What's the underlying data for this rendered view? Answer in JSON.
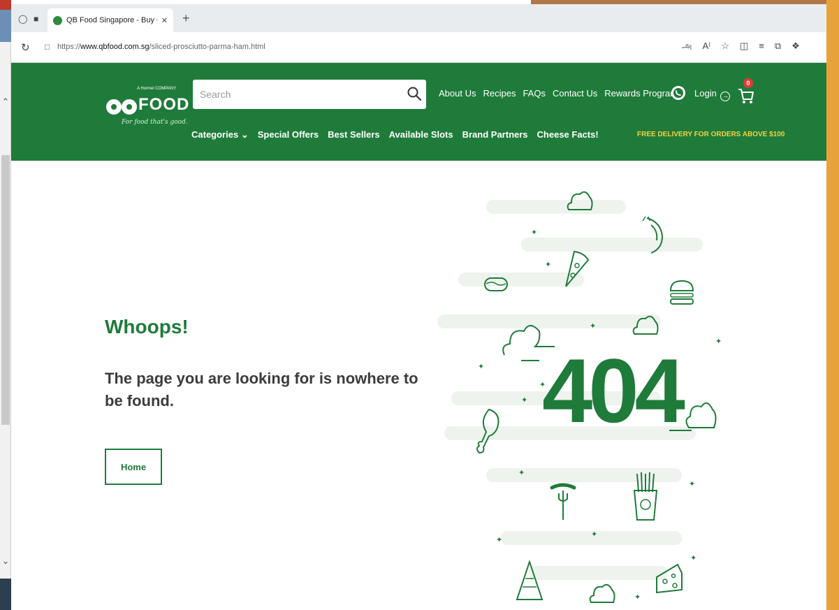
{
  "browser": {
    "tab_title": "QB Food Singapore - Buy Quality",
    "url_scheme": "https://",
    "url_host": "www.qbfood.com.sg",
    "url_path": "/sliced-prosciutto-parma-ham.html"
  },
  "header": {
    "logo": {
      "mark": "qb",
      "text": "FOOD",
      "company_line": "A Hormel COMPANY",
      "tagline": "For food that's good."
    },
    "search": {
      "placeholder": "Search"
    },
    "top_nav": [
      "About Us",
      "Recipes",
      "FAQs",
      "Contact Us",
      "Rewards Program"
    ],
    "login_label": "Login",
    "cart_count": "0",
    "sub_nav": {
      "categories_label": "Categories",
      "items": [
        "Special Offers",
        "Best Sellers",
        "Available Slots",
        "Brand Partners",
        "Cheese Facts!"
      ]
    },
    "free_delivery": "FREE DELIVERY FOR ORDERS ABOVE $100"
  },
  "main": {
    "heading": "Whoops!",
    "message": "The page you are looking for is nowhere to be found.",
    "home_button": "Home",
    "error_code": "404"
  },
  "colors": {
    "brand_green": "#1f7b3a",
    "delivery_yellow": "#f4d03f",
    "cart_badge": "#e53935"
  },
  "icons": [
    "reload-icon",
    "lock-icon",
    "search-icon",
    "whatsapp-icon",
    "login-icon",
    "cart-icon",
    "chevron-down-icon",
    "cloud-icon",
    "shrimp-icon",
    "pizza-icon",
    "hotdog-icon",
    "burger-icon",
    "drumstick-icon",
    "sausage-fork-icon",
    "fries-icon",
    "sandwich-icon",
    "cheese-icon"
  ]
}
